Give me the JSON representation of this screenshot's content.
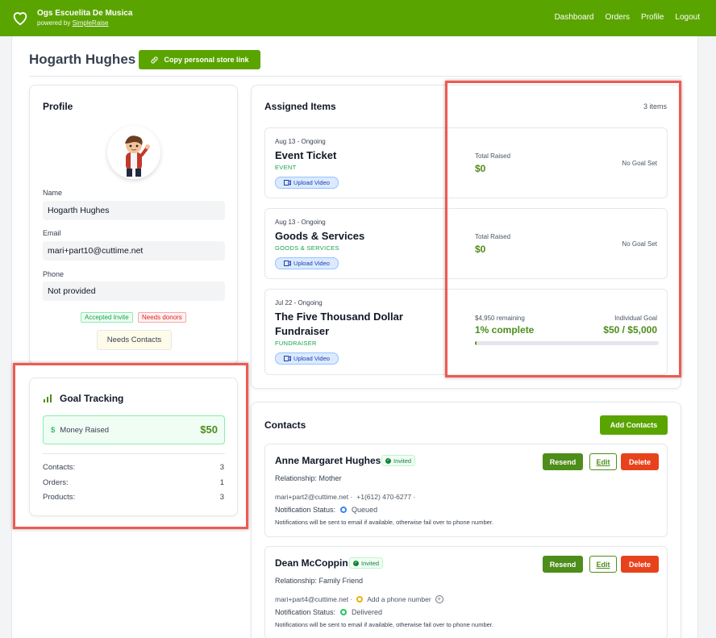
{
  "header": {
    "org_name": "Ogs Escuelita De Musica",
    "powered_by": "powered by",
    "powered_by_link": "SimpleRaise",
    "nav": [
      "Dashboard",
      "Orders",
      "Profile",
      "Logout"
    ]
  },
  "page": {
    "title": "Hogarth Hughes",
    "copy_link_label": "Copy personal store link"
  },
  "profile": {
    "heading": "Profile",
    "name_label": "Name",
    "name_value": "Hogarth Hughes",
    "email_label": "Email",
    "email_value": "mari+part10@cuttime.net",
    "phone_label": "Phone",
    "phone_value": "Not provided",
    "badges": [
      "Accepted Invite",
      "Needs donors"
    ],
    "needs_contacts": "Needs Contacts"
  },
  "goal_tracking": {
    "heading": "Goal Tracking",
    "money_raised_label": "Money Raised",
    "money_raised_value": "$50",
    "stats": [
      {
        "label": "Contacts:",
        "value": "3"
      },
      {
        "label": "Orders:",
        "value": "1"
      },
      {
        "label": "Products:",
        "value": "3"
      }
    ]
  },
  "assigned_items": {
    "heading": "Assigned Items",
    "count": "3 items",
    "upload_label": "Upload Video",
    "items": [
      {
        "date": "Aug 13 - Ongoing",
        "name": "Event Ticket",
        "category": "EVENT",
        "left_label": "Total Raised",
        "left_value": "$0",
        "right_label": "No Goal Set"
      },
      {
        "date": "Aug 13 - Ongoing",
        "name": "Goods & Services",
        "category": "GOODS & SERVICES",
        "left_label": "Total Raised",
        "left_value": "$0",
        "right_label": "No Goal Set"
      },
      {
        "date": "Jul 22 - Ongoing",
        "name_line1": "The Five Thousand Dollar",
        "name_line2": "Fundraiser",
        "category": "FUNDRAISER",
        "remaining": "$4,950 remaining",
        "complete": "1% complete",
        "goal_label": "Individual Goal",
        "goal_value": "$50 / $5,000",
        "progress": 1
      }
    ]
  },
  "contacts": {
    "heading": "Contacts",
    "add_label": "Add Contacts",
    "resend_label": "Resend",
    "edit_label": "Edit",
    "delete_label": "Delete",
    "invited_label": "Invited",
    "notification_label": "Notification Status:",
    "note": "Notifications will be sent to email if available, otherwise fail over to phone number.",
    "items": [
      {
        "name": "Anne Margaret Hughes",
        "relationship": "Relationship: Mother",
        "email": "mari+part2@cuttime.net ·",
        "phone": "+1(612) 470-6277 ·",
        "status": "Queued",
        "status_color": "#3b82f6"
      },
      {
        "name": "Dean McCoppin",
        "relationship": "Relationship: Family Friend",
        "email": "mari+part4@cuttime.net ·",
        "phone": "Add a phone number",
        "status": "Delivered",
        "status_color": "#22c55e",
        "phone_dot_color": "#eab308"
      }
    ]
  },
  "colors": {
    "brand": "#5aa400",
    "highlight": "#ef5a50",
    "delete": "#e8421c"
  }
}
